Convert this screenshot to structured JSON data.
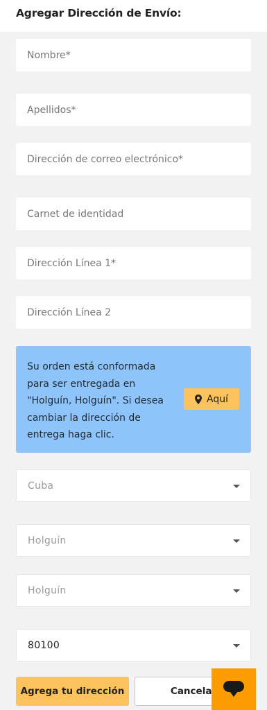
{
  "form": {
    "title": "Agregar Dirección de Envío:",
    "fields": {
      "nombre": {
        "placeholder": "Nombre*",
        "value": ""
      },
      "apellidos": {
        "placeholder": "Apellidos*",
        "value": ""
      },
      "email": {
        "placeholder": "Dirección de correo electrónico*",
        "value": ""
      },
      "carnet": {
        "placeholder": "Carnet de identidad",
        "value": ""
      },
      "linea1": {
        "placeholder": "Dirección Línea 1*",
        "value": ""
      },
      "linea2": {
        "placeholder": "Dirección Línea 2",
        "value": ""
      }
    },
    "info": {
      "text": "Su orden está conformada para ser entregada en \"Holguín, Holguín\". Si desea cambiar la dirección de entrega haga clic.",
      "button_label": "Aquí",
      "button_icon": "map-marker-icon"
    },
    "selects": {
      "country": "Cuba",
      "province": "Holguín",
      "municipality": "Holguín",
      "postal_code": "80100"
    },
    "buttons": {
      "submit": "Agrega tu dirección",
      "cancel": "Cancelar"
    }
  },
  "chat": {
    "icon": "chat-bubble-icon"
  },
  "colors": {
    "accent": "#fcc35c",
    "info_bg": "#8fc4fb",
    "chat_bg": "#fc9c00",
    "page_bg": "#f2f2f2"
  }
}
